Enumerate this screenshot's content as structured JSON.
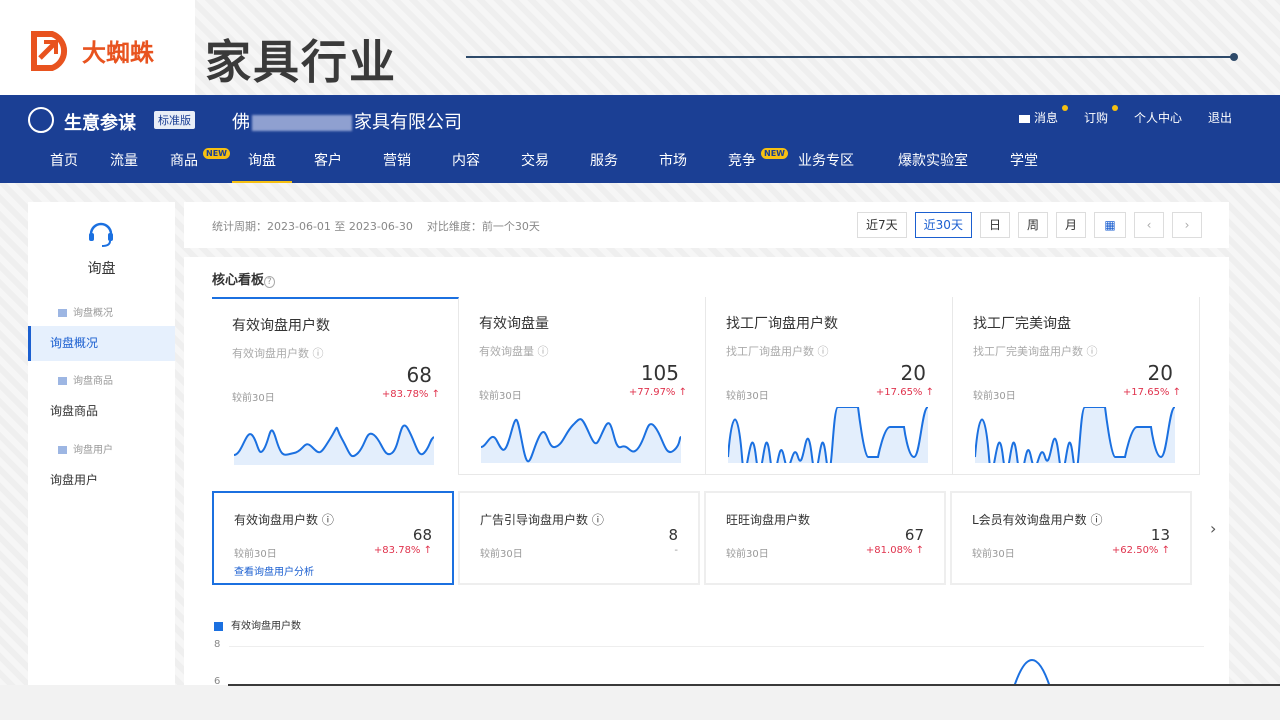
{
  "slide": {
    "logo_text": "大蜘蛛",
    "title": "家具行业"
  },
  "app": {
    "brand": "生意参谋",
    "badge": "标准版",
    "company_prefix": "佛",
    "company_suffix": "家具有限公司",
    "top_links": [
      "消息",
      "订购",
      "个人中心",
      "退出"
    ],
    "nav": [
      "首页",
      "流量",
      "商品",
      "询盘",
      "客户",
      "营销",
      "内容",
      "交易",
      "服务",
      "市场",
      "竞争",
      "业务专区",
      "爆款实验室",
      "学堂"
    ],
    "new_label": "NEW"
  },
  "sidebar": {
    "title": "询盘",
    "sub1": "询盘概况",
    "item1": "询盘概况",
    "sub2": "询盘商品",
    "item2": "询盘商品",
    "sub3": "询盘用户",
    "item3": "询盘用户"
  },
  "filter": {
    "period_label": "统计周期：",
    "period_value": "2023-06-01 至 2023-06-30",
    "compare_label": "对比维度：",
    "compare_value": "前一个30天",
    "buttons": [
      "近7天",
      "近30天",
      "日",
      "周",
      "月"
    ]
  },
  "panel": {
    "title": "核心看板",
    "q": "?"
  },
  "kpis": [
    {
      "name": "有效询盘用户数",
      "sub": "有效询盘用户数 ⓘ",
      "value": "68",
      "cmp": "较前30日",
      "pct": "+83.78% ↑"
    },
    {
      "name": "有效询盘量",
      "sub": "有效询盘量 ⓘ",
      "value": "105",
      "cmp": "较前30日",
      "pct": "+77.97% ↑"
    },
    {
      "name": "找工厂询盘用户数",
      "sub": "找工厂询盘用户数 ⓘ",
      "value": "20",
      "cmp": "较前30日",
      "pct": "+17.65% ↑"
    },
    {
      "name": "找工厂完美询盘",
      "sub": "找工厂完美询盘用户数 ⓘ",
      "value": "20",
      "cmp": "较前30日",
      "pct": "+17.65% ↑"
    }
  ],
  "cards": [
    {
      "name": "有效询盘用户数 ⓘ",
      "value": "68",
      "cmp": "较前30日",
      "pct": "+83.78% ↑",
      "link": "查看询盘用户分析"
    },
    {
      "name": "广告引导询盘用户数 ⓘ",
      "value": "8",
      "cmp": "较前30日",
      "pct": "-",
      "link": ""
    },
    {
      "name": "旺旺询盘用户数",
      "value": "67",
      "cmp": "较前30日",
      "pct": "+81.08% ↑",
      "link": ""
    },
    {
      "name": "L会员有效询盘用户数 ⓘ",
      "value": "13",
      "cmp": "较前30日",
      "pct": "+62.50% ↑",
      "link": ""
    }
  ],
  "chart": {
    "legend": "有效询盘用户数",
    "y_ticks": [
      "8",
      "6"
    ]
  },
  "colors": {
    "brand_blue": "#1b3f94",
    "accent": "#1b70e0",
    "up_red": "#e0334d",
    "logo_orange": "#e8531f"
  }
}
